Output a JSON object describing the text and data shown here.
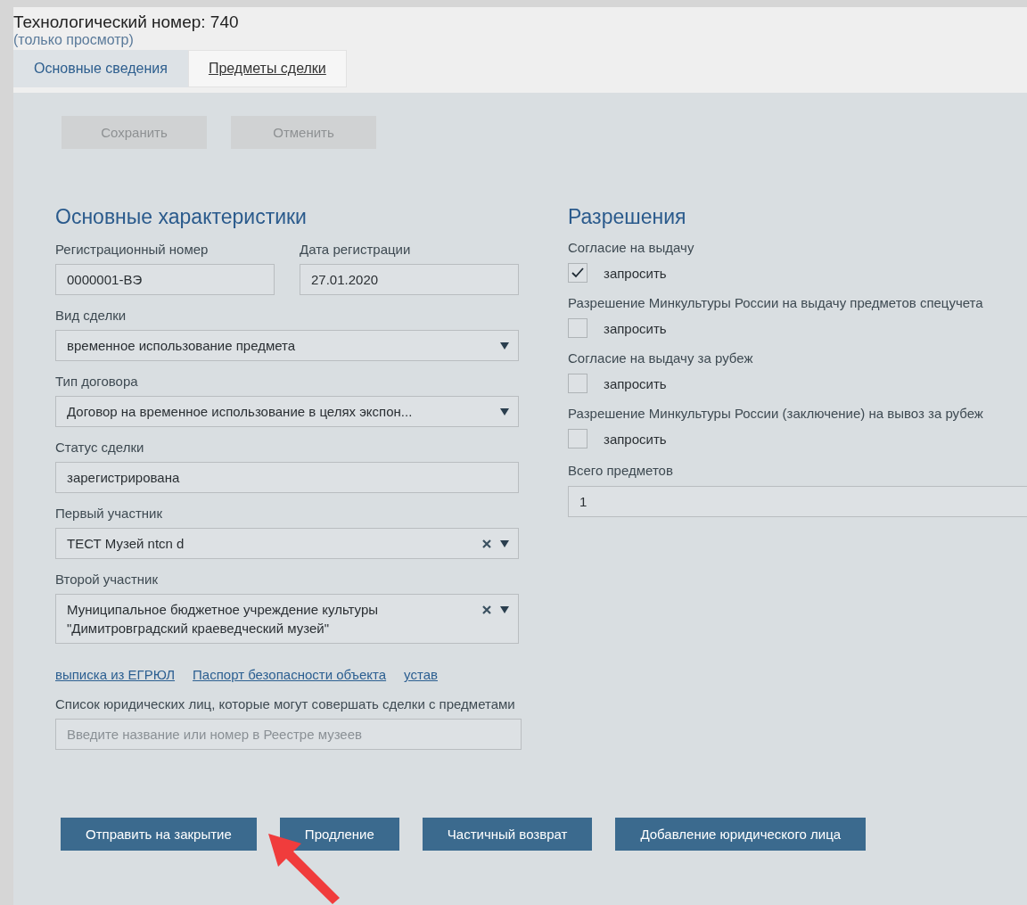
{
  "header": {
    "title": "Технологический номер: 740",
    "subtitle": "(только просмотр)"
  },
  "tabs": [
    {
      "label": "Основные сведения",
      "selected": true
    },
    {
      "label": "Предметы сделки",
      "selected": false
    }
  ],
  "toolbar_buttons": [
    {
      "label": "Сохранить",
      "disabled": true
    },
    {
      "label": "Отменить",
      "disabled": true
    }
  ],
  "main_section": {
    "title": "Основные характеристики",
    "fields": [
      {
        "kind": "pair",
        "items": [
          {
            "label": "Регистрационный номер",
            "value": "0000001-ВЭ"
          },
          {
            "label": "Дата регистрации",
            "value": "27.01.2020"
          }
        ]
      },
      {
        "kind": "select",
        "label": "Вид сделки",
        "value": "временное использование предмета",
        "clearable": false
      },
      {
        "kind": "select",
        "label": "Тип договора",
        "value": "Договор на временное использование в целях экспон...",
        "clearable": false
      },
      {
        "kind": "text",
        "label": "Статус сделки",
        "value": "зарегистрирована"
      },
      {
        "kind": "select",
        "label": "Первый участник",
        "value": "ТЕСТ Музей ntcn d",
        "clearable": true
      },
      {
        "kind": "select",
        "label": "Второй участник",
        "value": "Муниципальное бюджетное учреждение культуры \"Димитровградский краеведческий музей\"",
        "clearable": true
      },
      {
        "kind": "links",
        "items": [
          "выписка из ЕГРЮЛ",
          "Паспорт безопасности объекта",
          "устав"
        ]
      },
      {
        "kind": "search",
        "label": "Список юридических лиц, которые могут совершать сделки с предметами",
        "placeholder": "Введите название или номер в Реестре музеев"
      }
    ]
  },
  "permissions_section": {
    "title": "Разрешения",
    "items": [
      {
        "label": "Согласие на выдачу",
        "checkbox_label": "запросить",
        "checked": true
      },
      {
        "label": "Разрешение Минкультуры России на выдачу предметов спецучета",
        "checkbox_label": "запросить",
        "checked": false
      },
      {
        "label": "Согласие на выдачу за рубеж",
        "checkbox_label": "запросить",
        "checked": false
      },
      {
        "label": "Разрешение Минкультуры России (заключение) на вывоз за рубеж",
        "checkbox_label": "запросить",
        "checked": false
      }
    ],
    "total": {
      "label": "Всего предметов",
      "value": "1"
    }
  },
  "action_buttons": [
    "Отправить на закрытие",
    "Продление",
    "Частичный возврат",
    "Добавление юридического лица"
  ]
}
